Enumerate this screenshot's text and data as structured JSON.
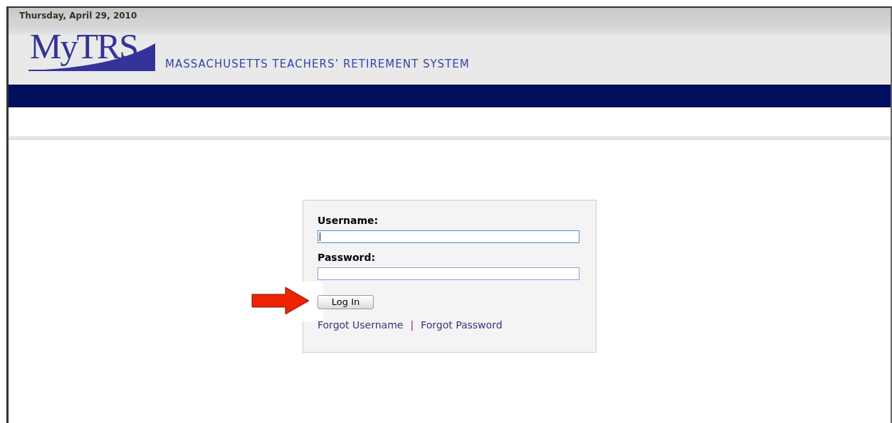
{
  "header": {
    "date": "Thursday, April 29, 2010",
    "logo": "MyTRS",
    "org_name": "MASSACHUSETTS TEACHERS’ RETIREMENT SYSTEM"
  },
  "login": {
    "fields": [
      {
        "label": "Username:",
        "focused": true
      },
      {
        "label": "Password:",
        "focused": false
      }
    ],
    "button": "Log In",
    "links": [
      "Forgot Username",
      "Forgot Password"
    ],
    "separator": "|"
  }
}
